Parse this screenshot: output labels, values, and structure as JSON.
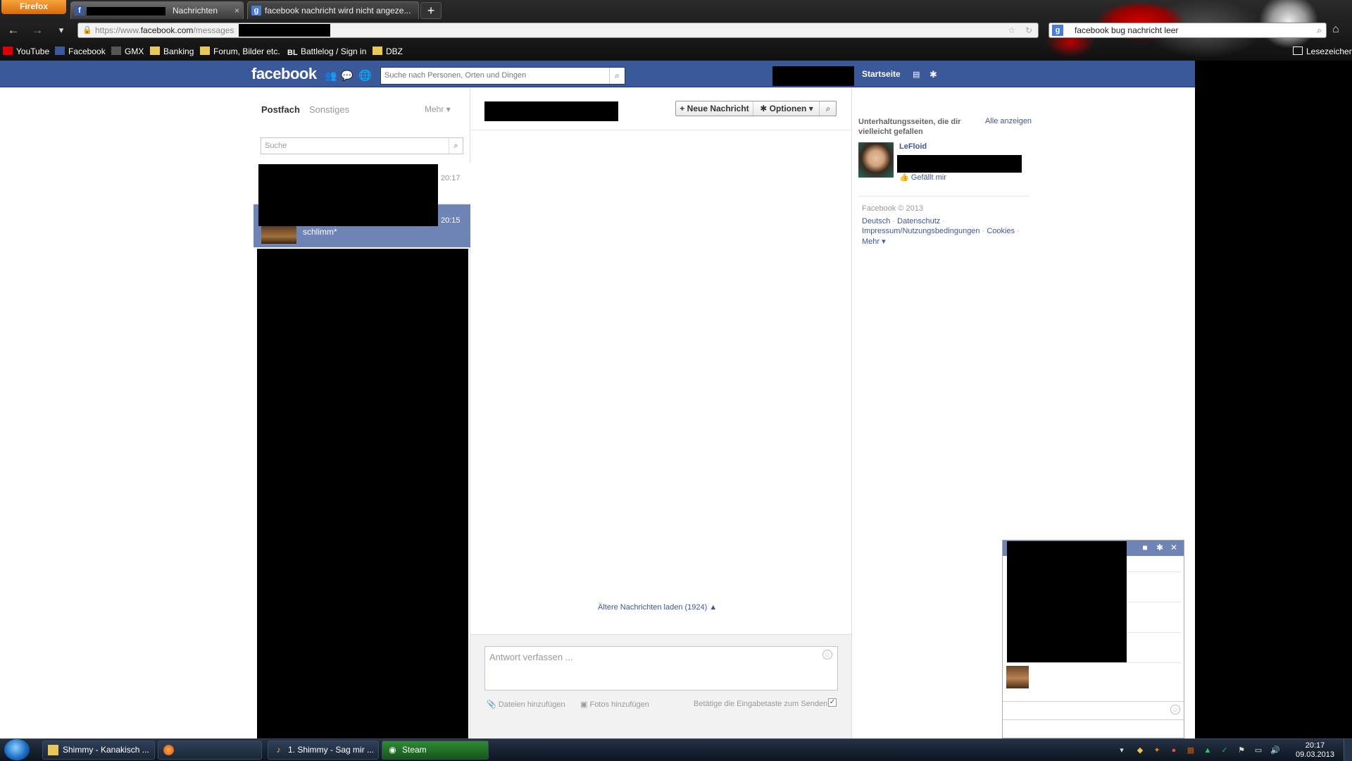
{
  "browser": {
    "menu_label": "Firefox",
    "tabs": [
      {
        "label": "Nachrichten",
        "icon": "facebook-icon"
      },
      {
        "label": "facebook nachricht wird nicht angeze...",
        "icon": "google-icon"
      }
    ],
    "new_tab": "+",
    "url_prefix": "https://www.",
    "url_domain": "facebook.com",
    "url_path": "/messages",
    "search_value": "facebook bug nachricht leer",
    "bookmarks_label": "Lesezeichen",
    "bookmarks": [
      "YouTube",
      "Facebook",
      "GMX",
      "Banking",
      "Forum, Bilder etc.",
      "Battlelog / Sign in",
      "DBZ"
    ]
  },
  "fb": {
    "logo": "facebook",
    "search_placeholder": "Suche nach Personen, Orten und Dingen",
    "home_link": "Startseite",
    "colors": {
      "blue": "#3b5998",
      "selected": "#6d84b4"
    }
  },
  "inbox": {
    "tab_postfach": "Postfach",
    "tab_sonstiges": "Sonstiges",
    "mehr": "Mehr",
    "search_placeholder": "Suche",
    "threads": [
      {
        "time": "20:17",
        "snippet": ""
      },
      {
        "time": "20:15",
        "snippet": "schlimm*"
      }
    ]
  },
  "conversation": {
    "new_message": "Neue Nachricht",
    "options": "Optionen",
    "older": "Ältere Nachrichten laden (1924)",
    "reply_placeholder": "Antwort verfassen ...",
    "add_files": "Dateien hinzufügen",
    "add_photos": "Fotos hinzufügen",
    "enter_to_send": "Betätige die Eingabetaste zum Senden"
  },
  "sidebar": {
    "title": "Unterhaltungsseiten, die dir vielleicht gefallen",
    "see_all": "Alle anzeigen",
    "page_name": "LeFloid",
    "like": "Gefällt mir",
    "copyright": "Facebook © 2013",
    "lang": "Deutsch",
    "privacy": "Datenschutz",
    "imprint": "Impressum/Nutzungsbedingungen",
    "cookies": "Cookies",
    "more": "Mehr"
  },
  "taskbar": {
    "items": [
      "Shimmy - Kanakisch ...",
      "1. Shimmy - Sag mir ...",
      "Steam"
    ],
    "time": "20:17",
    "date": "09.03.2013"
  }
}
